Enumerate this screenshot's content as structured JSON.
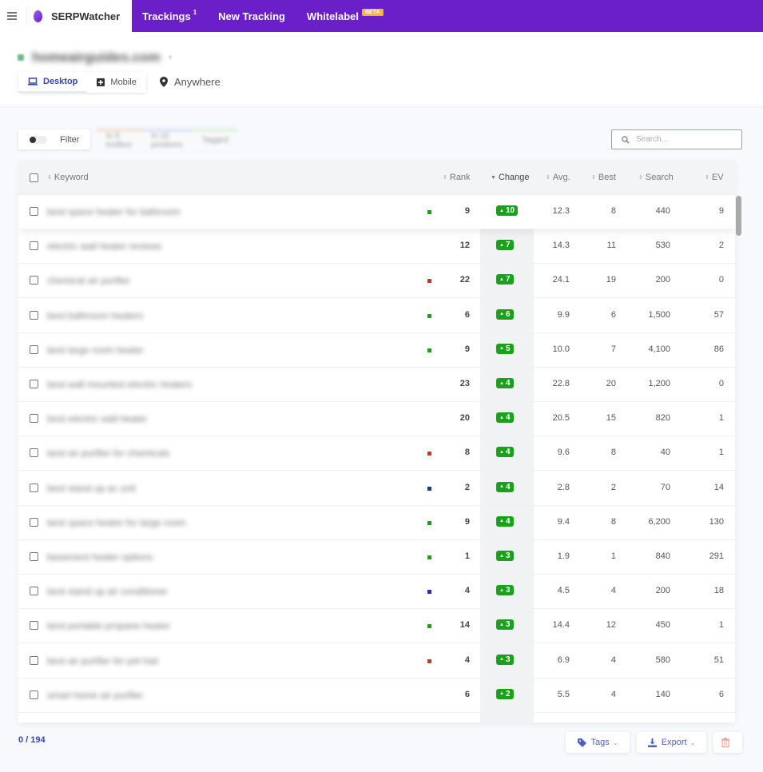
{
  "app": {
    "brand": "SERPWatcher",
    "nav": [
      {
        "label": "Trackings",
        "badge": "1"
      },
      {
        "label": "New Tracking"
      },
      {
        "label": "Whitelabel",
        "tag": "BETA"
      }
    ]
  },
  "header": {
    "domain": "homeairguides.com",
    "devices": [
      "Desktop",
      "Mobile"
    ],
    "active_device": "Desktop",
    "location": "Anywhere"
  },
  "toolbar": {
    "filter_label": "Filter",
    "chips": [
      "In 5 toolbox",
      "In 10 positions",
      "Tagged"
    ],
    "search_placeholder": "Search..."
  },
  "table": {
    "columns": {
      "keyword": "Keyword",
      "rank": "Rank",
      "change": "Change",
      "avg": "Avg.",
      "best": "Best",
      "search": "Search",
      "ev": "EV"
    },
    "sorted_by": "Change",
    "rows": [
      {
        "keyword": "best space heater for bathroom",
        "dot": "#1f9d1f",
        "rank": "9",
        "change": "10",
        "avg": "12.3",
        "best": "8",
        "search": "440",
        "ev": "9"
      },
      {
        "keyword": "electric wall heater reviews",
        "dot": null,
        "rank": "12",
        "change": "7",
        "avg": "14.3",
        "best": "11",
        "search": "530",
        "ev": "2"
      },
      {
        "keyword": "chemical air purifier",
        "dot": "#c0392b",
        "rank": "22",
        "change": "7",
        "avg": "24.1",
        "best": "19",
        "search": "200",
        "ev": "0"
      },
      {
        "keyword": "best bathroom heaters",
        "dot": "#1f9d1f",
        "rank": "6",
        "change": "6",
        "avg": "9.9",
        "best": "6",
        "search": "1,500",
        "ev": "57"
      },
      {
        "keyword": "best large room heater",
        "dot": "#1f9d1f",
        "rank": "9",
        "change": "5",
        "avg": "10.0",
        "best": "7",
        "search": "4,100",
        "ev": "86"
      },
      {
        "keyword": "best wall mounted electric heaters",
        "dot": null,
        "rank": "23",
        "change": "4",
        "avg": "22.8",
        "best": "20",
        "search": "1,200",
        "ev": "0"
      },
      {
        "keyword": "best electric wall heater",
        "dot": null,
        "rank": "20",
        "change": "4",
        "avg": "20.5",
        "best": "15",
        "search": "820",
        "ev": "1"
      },
      {
        "keyword": "best air purifier for chemicals",
        "dot": "#c0392b",
        "rank": "8",
        "change": "4",
        "avg": "9.6",
        "best": "8",
        "search": "40",
        "ev": "1"
      },
      {
        "keyword": "best stand up ac unit",
        "dot": "#1a2fb5",
        "rank": "2",
        "change": "4",
        "avg": "2.8",
        "best": "2",
        "search": "70",
        "ev": "14"
      },
      {
        "keyword": "best space heater for large room",
        "dot": "#1f9d1f",
        "rank": "9",
        "change": "4",
        "avg": "9.4",
        "best": "8",
        "search": "6,200",
        "ev": "130"
      },
      {
        "keyword": "basement heater options",
        "dot": "#1f9d1f",
        "rank": "1",
        "change": "3",
        "avg": "1.9",
        "best": "1",
        "search": "840",
        "ev": "291"
      },
      {
        "keyword": "best stand up air conditioner",
        "dot": "#1a2fb5",
        "rank": "4",
        "change": "3",
        "avg": "4.5",
        "best": "4",
        "search": "200",
        "ev": "18"
      },
      {
        "keyword": "best portable propane heater",
        "dot": "#1f9d1f",
        "rank": "14",
        "change": "3",
        "avg": "14.4",
        "best": "12",
        "search": "450",
        "ev": "1"
      },
      {
        "keyword": "best air purifier for pet hair",
        "dot": "#c0392b",
        "rank": "4",
        "change": "3",
        "avg": "6.9",
        "best": "4",
        "search": "580",
        "ev": "51"
      },
      {
        "keyword": "smart home air purifier",
        "dot": null,
        "rank": "6",
        "change": "2",
        "avg": "5.5",
        "best": "4",
        "search": "140",
        "ev": "6"
      }
    ]
  },
  "footer": {
    "selection": "0 / 194",
    "tags_label": "Tags",
    "export_label": "Export"
  },
  "colors": {
    "brand_purple": "#6a1fc9",
    "accent_blue": "#3646b9",
    "change_green": "#19a119",
    "chip_colors": [
      "#f4c9a8",
      "#c9cdf5",
      "#cde8c8"
    ]
  }
}
